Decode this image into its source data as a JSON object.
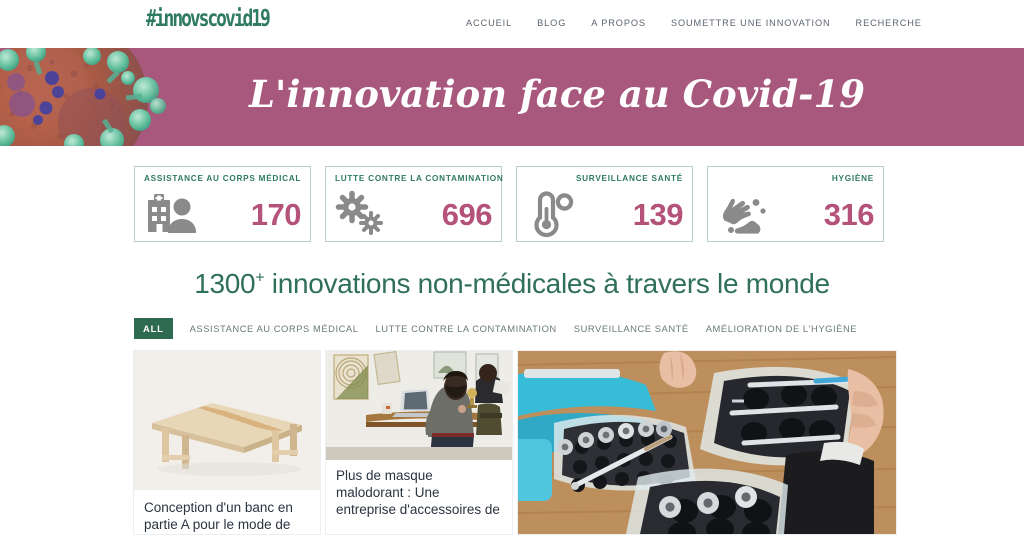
{
  "header": {
    "logo": "#innovscovid19",
    "nav": [
      {
        "label": "ACCUEIL",
        "name": "nav-accueil"
      },
      {
        "label": "BLOG",
        "name": "nav-blog"
      },
      {
        "label": "A PROPOS",
        "name": "nav-a-propos"
      },
      {
        "label": "SOUMETTRE UNE INNOVATION",
        "name": "nav-soumettre"
      },
      {
        "label": "RECHERCHE",
        "name": "nav-recherche"
      }
    ]
  },
  "hero": {
    "title": "L'innovation face au Covid-19",
    "background_color": "#a8577d",
    "image_alt": "coronavirus-3d-render"
  },
  "stats": [
    {
      "label": "ASSISTANCE AU CORPS MÉDICAL",
      "value": "170",
      "icon": "hospital-person-icon"
    },
    {
      "label": "LUTTE CONTRE LA CONTAMINATION",
      "value": "696",
      "icon": "virus-germs-icon"
    },
    {
      "label": "SURVEILLANCE SANTÉ",
      "value": "139",
      "icon": "thermometer-icon"
    },
    {
      "label": "HYGIÈNE",
      "value": "316",
      "icon": "handwash-icon"
    }
  ],
  "section": {
    "count": "1300",
    "plus": "+",
    "heading_rest": " innovations non-médicales à travers le monde"
  },
  "filters": [
    {
      "label": "ALL",
      "active": true
    },
    {
      "label": "ASSISTANCE AU CORPS MÉDICAL",
      "active": false
    },
    {
      "label": "LUTTE CONTRE LA CONTAMINATION",
      "active": false
    },
    {
      "label": "SURVEILLANCE SANTÉ",
      "active": false
    },
    {
      "label": "AMÉLIORATION DE L'HYGIÈNE",
      "active": false
    }
  ],
  "cards": [
    {
      "title": "Conception d'un banc en partie A pour le mode de",
      "image_alt": "wooden-slatted-bench"
    },
    {
      "title": "Plus de masque malodorant : Une entreprise d'accessoires de",
      "image_alt": "man-wearing-mask-at-desk-with-laptop"
    },
    {
      "title": "",
      "image_alt": "vaccine-vials-in-foam-lined-containers"
    }
  ],
  "colors": {
    "brand_green": "#2f7a63",
    "hero_magenta": "#a8577d",
    "stat_number": "#b4527a",
    "filter_active": "#2d6a4f"
  }
}
